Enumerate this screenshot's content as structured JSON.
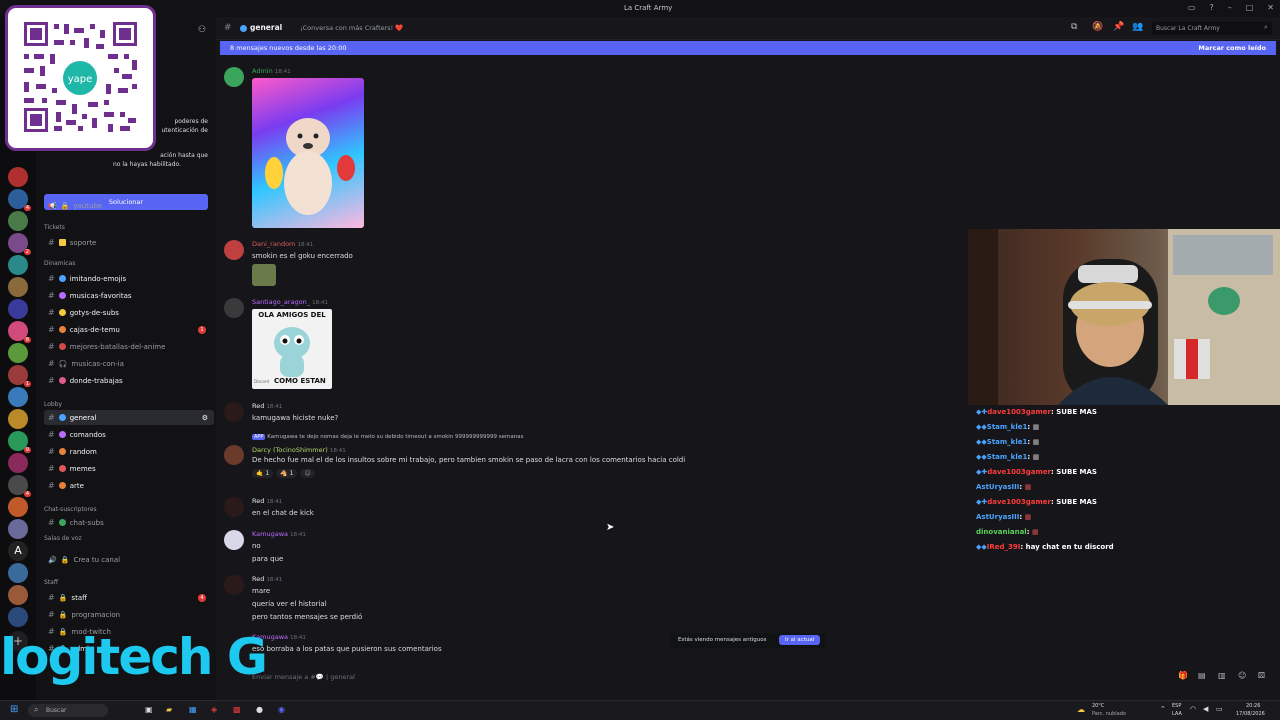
{
  "window": {
    "title": "La Craft Army"
  },
  "channel_header": {
    "name": "general",
    "topic": "¡Conversa con más Crafters! ❤️",
    "search_placeholder": "Buscar La Craft Army"
  },
  "new_messages_bar": {
    "text": "8 mensajes nuevos desde las 20:00",
    "action": "Marcar como leído"
  },
  "sidebar_alert": {
    "line1": "poderes de",
    "line2": "utenticación de",
    "line3": "ación hasta que",
    "line4": "no la hayas habilitado.",
    "button": "Solucionar"
  },
  "qr": {
    "brand": "yape"
  },
  "categories": {
    "tickets": "Tickets",
    "dinamicas": "Dinamicas",
    "lobby": "Lobby",
    "chat_sub": "Chat-suscriptores",
    "salas": "Salas de voz",
    "staff": "Staff"
  },
  "channels": [
    {
      "label": "youtube"
    },
    {
      "label": "soporte"
    },
    {
      "label": "imitando-emojis"
    },
    {
      "label": "musicas-favoritas"
    },
    {
      "label": "gotys-de-subs"
    },
    {
      "label": "cajas-de-temu"
    },
    {
      "label": "mejores-batallas-del-anime"
    },
    {
      "label": "musicas-con-ia"
    },
    {
      "label": "donde-trabajas"
    },
    {
      "label": "general"
    },
    {
      "label": "comandos"
    },
    {
      "label": "random"
    },
    {
      "label": "memes"
    },
    {
      "label": "arte"
    },
    {
      "label": "chat-subs"
    },
    {
      "label": "Crea tu canal"
    },
    {
      "label": "staff"
    },
    {
      "label": "programacion"
    },
    {
      "label": "mod-twitch"
    },
    {
      "label": "admin"
    }
  ],
  "messages": [
    {
      "author": "Admin",
      "time": "18:41",
      "text": ""
    },
    {
      "author": "Dani_random",
      "time": "18:41",
      "text": "smokin es el goku encerrado"
    },
    {
      "author": "Santiago_aragon_",
      "time": "18:41",
      "text": "",
      "img_top": "OLA AMIGOS DEL",
      "img_bottom": "COMO ESTAN",
      "img_left": "Discord"
    },
    {
      "author": "Red",
      "time": "18:41",
      "text": "kamugawa hiciste nuke?"
    },
    {
      "author": "Darcy (TocinoShimmer)",
      "time": "18:41",
      "reply": "Kamugawa te dejo nomas deja le meto su debido timeout a smokin 999999999999 semanas",
      "text": "De hecho fue mal el de los insultos sobre mi trabajo, pero tambien smokin se paso de lacra con los comentarios hacia coldi"
    },
    {
      "author": "Red",
      "time": "18:41",
      "text": "en el chat de kick"
    },
    {
      "author": "Kamugawa",
      "time": "18:41",
      "text": "no",
      "text2": "para que"
    },
    {
      "author": "Red",
      "time": "18:41",
      "text": "mare",
      "text2": "quería ver el historial",
      "text3": "pero tantos mensajes se perdió"
    },
    {
      "author": "Kamugawa",
      "time": "18:41",
      "text": "eso borraba a los patas que pusieron sus comentarios"
    }
  ],
  "reactions": [
    "1",
    "1"
  ],
  "viewing_banner": {
    "text": "Estás viendo mensajes antiguos",
    "button": "Ir al actual"
  },
  "input": {
    "placeholder": "Enviar mensaje a #💬 | general"
  },
  "stream_chat": [
    {
      "user": "dave1003gamer",
      "msg": ": SUBE MAS",
      "color": "#ff3b3b"
    },
    {
      "user": "Stam_kle1",
      "msg": ":",
      "color": "#4aa3ff"
    },
    {
      "user": "Stam_kle1",
      "msg": ":",
      "color": "#4aa3ff"
    },
    {
      "user": "Stam_kle1",
      "msg": ":",
      "color": "#4aa3ff"
    },
    {
      "user": "dave1003gamer",
      "msg": ": SUBE MAS",
      "color": "#ff3b3b"
    },
    {
      "user": "AstUryasIII",
      "msg": ":",
      "color": "#4aa3ff"
    },
    {
      "user": "dave1003gamer",
      "msg": ": SUBE MAS",
      "color": "#ff3b3b"
    },
    {
      "user": "AstUryasIII",
      "msg": ":",
      "color": "#4aa3ff"
    },
    {
      "user": "dinovanianal",
      "msg": ":",
      "color": "#5bd15b"
    },
    {
      "user": "IRed_39I",
      "msg": ": hay chat   en tu discord",
      "color": "#ff3b3b"
    }
  ],
  "overlay": {
    "logo": "logitech G"
  },
  "taskbar": {
    "search": "Buscar",
    "weather_temp": "20°C",
    "weather_desc": "Parc. nublado",
    "lang1": "ESP",
    "lang2": "LAA",
    "time": "20:26",
    "date": "17/08/2026"
  },
  "colors": {
    "accent": "#5865f2",
    "badge": "#e23a3a",
    "admin": "#3ba55d",
    "dani": "#e05a5a",
    "santiago": "#b86bff",
    "red": "#e8e8e8",
    "darcy": "#b6d86b",
    "kamugawa": "#b86bff"
  }
}
